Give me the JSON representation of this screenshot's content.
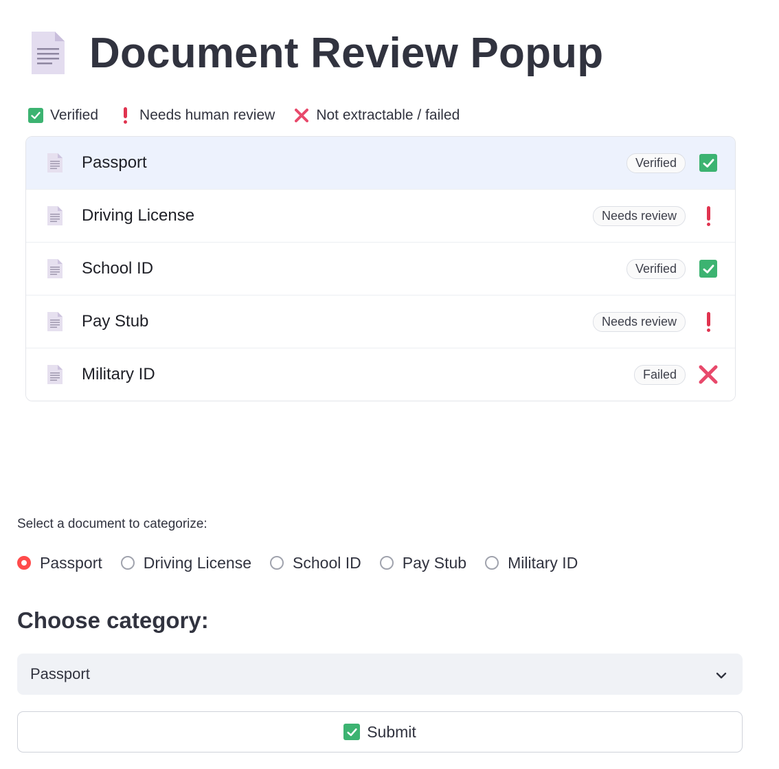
{
  "header": {
    "title": "Document Review Popup",
    "icon": "document-icon"
  },
  "legend": {
    "verified_label": "Verified",
    "review_label": "Needs human review",
    "failed_label": "Not extractable / failed"
  },
  "documents": [
    {
      "name": "Passport",
      "badge": "Verified",
      "status": "verified",
      "selected": true
    },
    {
      "name": "Driving License",
      "badge": "Needs review",
      "status": "review",
      "selected": false
    },
    {
      "name": "School ID",
      "badge": "Verified",
      "status": "verified",
      "selected": false
    },
    {
      "name": "Pay Stub",
      "badge": "Needs review",
      "status": "review",
      "selected": false
    },
    {
      "name": "Military ID",
      "badge": "Failed",
      "status": "failed",
      "selected": false
    }
  ],
  "selector": {
    "label": "Select a document to categorize:",
    "options": [
      "Passport",
      "Driving License",
      "School ID",
      "Pay Stub",
      "Military ID"
    ],
    "selected": "Passport"
  },
  "category": {
    "heading": "Choose category:",
    "value": "Passport"
  },
  "submit": {
    "label": "Submit",
    "icon": "check-icon"
  },
  "colors": {
    "verified": "#3cb371",
    "review": "#e0334f",
    "failed": "#e8496b",
    "radio_accent": "#ff4b4b",
    "selected_row": "#edf2fd"
  }
}
